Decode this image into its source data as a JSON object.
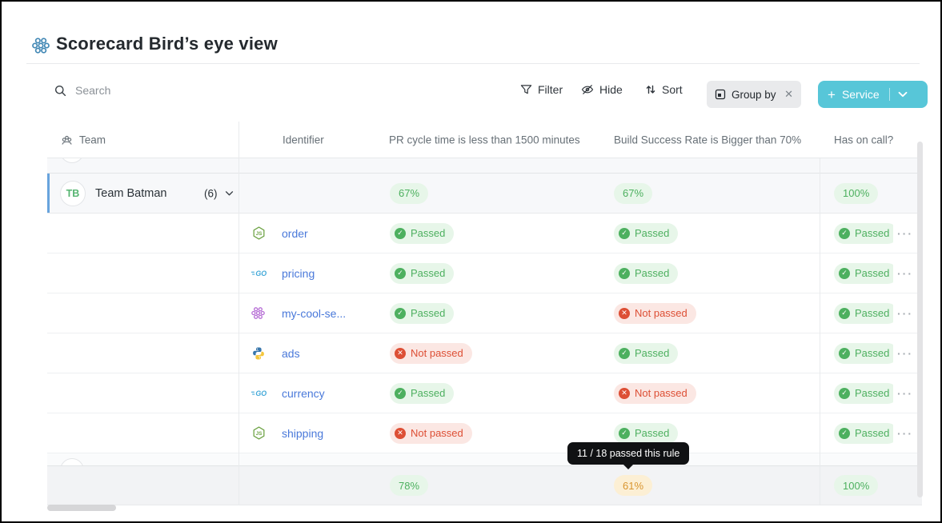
{
  "window": {
    "title": "Scorecard Bird’s eye view"
  },
  "toolbar": {
    "search_placeholder": "Search",
    "filter_label": "Filter",
    "hide_label": "Hide",
    "sort_label": "Sort",
    "group_by_label": "Group by",
    "service_button_label": "Service"
  },
  "table": {
    "columns": {
      "team": "Team",
      "identifier": "Identifier",
      "rule1": "PR cycle time is less than 1500 minutes",
      "rule2": "Build Success Rate is Bigger than 70%",
      "rule3": "Has on call?"
    },
    "group": {
      "avatar_initials": "TB",
      "name": "Team Batman",
      "count": "(6)",
      "percentages": [
        {
          "value": "67%",
          "tone": "good"
        },
        {
          "value": "67%",
          "tone": "good"
        },
        {
          "value": "100%",
          "tone": "good"
        }
      ]
    },
    "rows": [
      {
        "icon": "nodejs-icon",
        "name": "order",
        "statuses": [
          {
            "label": "Passed",
            "tone": "pass"
          },
          {
            "label": "Passed",
            "tone": "pass"
          },
          {
            "label": "Passed",
            "tone": "pass"
          }
        ]
      },
      {
        "icon": "go-icon",
        "name": "pricing",
        "statuses": [
          {
            "label": "Passed",
            "tone": "pass"
          },
          {
            "label": "Passed",
            "tone": "pass"
          },
          {
            "label": "Passed",
            "tone": "pass"
          }
        ]
      },
      {
        "icon": "microservice-cluster-icon",
        "name": "my-cool-se...",
        "statuses": [
          {
            "label": "Passed",
            "tone": "pass"
          },
          {
            "label": "Not passed",
            "tone": "fail"
          },
          {
            "label": "Passed",
            "tone": "pass"
          }
        ]
      },
      {
        "icon": "python-icon",
        "name": "ads",
        "statuses": [
          {
            "label": "Not passed",
            "tone": "fail"
          },
          {
            "label": "Passed",
            "tone": "pass"
          },
          {
            "label": "Passed",
            "tone": "pass"
          }
        ]
      },
      {
        "icon": "go-icon",
        "name": "currency",
        "statuses": [
          {
            "label": "Passed",
            "tone": "pass"
          },
          {
            "label": "Not passed",
            "tone": "fail"
          },
          {
            "label": "Passed",
            "tone": "pass"
          }
        ]
      },
      {
        "icon": "nodejs-icon",
        "name": "shipping",
        "statuses": [
          {
            "label": "Not passed",
            "tone": "fail"
          },
          {
            "label": "Passed",
            "tone": "pass"
          },
          {
            "label": "Passed",
            "tone": "pass"
          }
        ]
      }
    ],
    "next_group": {
      "percentages": [
        {
          "value": "78%",
          "tone": "good"
        },
        {
          "value": "61%",
          "tone": "warn"
        },
        {
          "value": "100%",
          "tone": "good"
        }
      ]
    }
  },
  "tooltip": {
    "text": "11 / 18 passed this rule"
  },
  "icons": {
    "title": "scorecard-cluster-icon",
    "search": "search-icon",
    "filter": "filter-funnel-icon",
    "hide": "eye-off-icon",
    "sort": "sort-arrows-icon",
    "group_by": "group-by-icon",
    "chip_close": "close-icon",
    "service_plus": "plus-icon",
    "service_chevron": "chevron-down-icon",
    "team_header": "people-icon",
    "group_chevron": "chevron-down-icon",
    "pass": "check-circle-icon",
    "fail": "x-circle-icon",
    "row_menu": "ellipsis-icon"
  },
  "colors": {
    "accent_teal": "#57c6d8",
    "status_pass": "#4db05f",
    "status_fail": "#dd4f35",
    "status_warn": "#d9952f",
    "link_blue": "#4a79da",
    "selected_row_bar": "#68a4dd",
    "tooltip_bg": "#101113"
  }
}
